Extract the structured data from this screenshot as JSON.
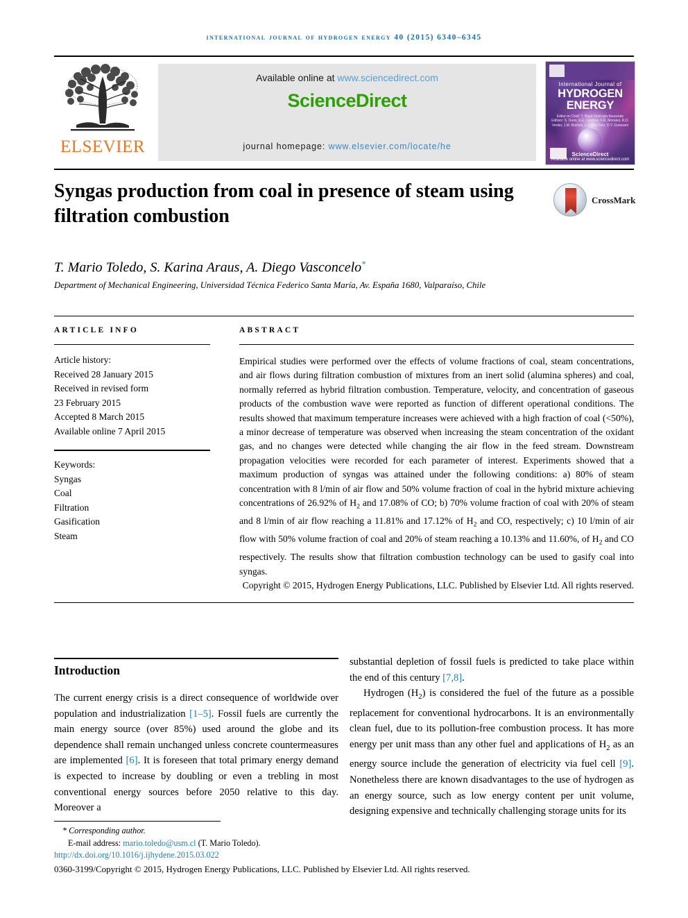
{
  "running_head": "International Journal of Hydrogen Energy 40 (2015) 6340–6345",
  "masthead": {
    "publisher_name": "ELSEVIER",
    "available_prefix": "Available online at ",
    "available_link": "www.sciencedirect.com",
    "sciencedirect_logo": "ScienceDirect",
    "homepage_prefix": "journal homepage: ",
    "homepage_link": "www.elsevier.com/locate/he",
    "colors": {
      "elsevier_orange": "#E87722",
      "sciencedirect_green": "#2CA005",
      "link_blue": "#3F86C4",
      "running_head_blue": "#1A6FA8"
    }
  },
  "cover": {
    "line1": "International Journal of",
    "line2": "HYDROGEN",
    "line3": "ENERGY",
    "editors": "Editor-in-Chief: T. Nejat Veziroglu   Associate Editors: S. Dunn, E.E. Gardner, F.R. Morales, R.D. Venter, J.M. Bockris, L.J. Tho-Tam, D.Y. Goswami",
    "footer": "Available online at www.sciencedirect.com",
    "sciencedirect": "ScienceDirect"
  },
  "article": {
    "title": "Syngas production from coal in presence of steam using filtration combustion",
    "crossmark_label": "CrossMark",
    "authors": "T. Mario Toledo, S. Karina Araus, A. Diego Vasconcelo",
    "corresponding_marker": "*",
    "affiliation": "Department of Mechanical Engineering, Universidad Técnica Federico Santa María, Av. España 1680, Valparaíso, Chile"
  },
  "info": {
    "heading": "ARTICLE INFO",
    "history_label": "Article history:",
    "history": [
      "Received 28 January 2015",
      "Received in revised form",
      "23 February 2015",
      "Accepted 8 March 2015",
      "Available online 7 April 2015"
    ],
    "keywords_label": "Keywords:",
    "keywords": [
      "Syngas",
      "Coal",
      "Filtration",
      "Gasification",
      "Steam"
    ]
  },
  "abstract": {
    "heading": "ABSTRACT",
    "part1": "Empirical studies were performed over the effects of volume fractions of coal, steam concentrations, and air flows during filtration combustion of mixtures from an inert solid (alumina spheres) and coal, normally referred as hybrid filtration combustion. Temperature, velocity, and concentration of gaseous products of the combustion wave were reported as function of different operational conditions. The results showed that maximum temperature increases were achieved with a high fraction of coal (<50%), a minor decrease of temperature was observed when increasing the steam concentration of the oxidant gas, and no changes were detected while changing the air flow in the feed stream. Downstream propagation velocities were recorded for each parameter of interest. Experiments showed that a maximum production of syngas was attained under the following conditions: a) 80% of steam concentration with 8 l/min of air flow and 50% volume fraction of coal in the hybrid mixture achieving concentrations of 26.92% of H",
    "sub1": "2",
    "part2": " and 17.08% of CO; b) 70% volume fraction of coal with 20% of steam and 8 l/min of air flow reaching a 11.81% and 17.12% of H",
    "sub2": "2",
    "part3": " and CO, respectively; c) 10 l/min of air flow with 50% volume fraction of coal and 20% of steam reaching a 10.13% and 11.60%, of H",
    "sub3": "2",
    "part4": " and CO respectively. The results show that filtration combustion technology can be used to gasify coal into syngas.",
    "copyright": "Copyright © 2015, Hydrogen Energy Publications, LLC. Published by Elsevier Ltd. All rights reserved."
  },
  "body": {
    "intro_heading": "Introduction",
    "left_p1_a": "The current energy crisis is a direct consequence of worldwide over population and industrialization ",
    "left_ref1": "[1–5]",
    "left_p1_b": ". Fossil fuels are currently the main energy source (over 85%) used around the globe and its dependence shall remain unchanged unless concrete countermeasures are implemented ",
    "left_ref2": "[6]",
    "left_p1_c": ". It is foreseen that total primary energy demand is expected to increase by doubling or even a trebling in most conventional energy sources before 2050 relative to this day. Moreover a",
    "right_p1_a": "substantial depletion of fossil fuels is predicted to take place within the end of this century ",
    "right_ref1": "[7,8]",
    "right_p1_b": ".",
    "right_p2_a": "Hydrogen (H",
    "right_p2_sub": "2",
    "right_p2_b": ") is considered the fuel of the future as a possible replacement for conventional hydrocarbons. It is an environmentally clean fuel, due to its pollution-free combustion process. It has more energy per unit mass than any other fuel and applications of H",
    "right_p2_sub2": "2",
    "right_p2_c": " as an energy source include the generation of electricity via fuel cell ",
    "right_ref2": "[9]",
    "right_p2_d": ". Nonetheless there are known disadvantages to the use of hydrogen as an energy source, such as low energy content per unit volume, designing expensive and technically challenging storage units for its"
  },
  "footer": {
    "corresponding": "* Corresponding author.",
    "email_label": "E-mail address: ",
    "email": "mario.toledo@usm.cl",
    "email_suffix": " (T. Mario Toledo).",
    "doi": "http://dx.doi.org/10.1016/j.ijhydene.2015.03.022",
    "copyright": "0360-3199/Copyright © 2015, Hydrogen Energy Publications, LLC. Published by Elsevier Ltd. All rights reserved."
  }
}
